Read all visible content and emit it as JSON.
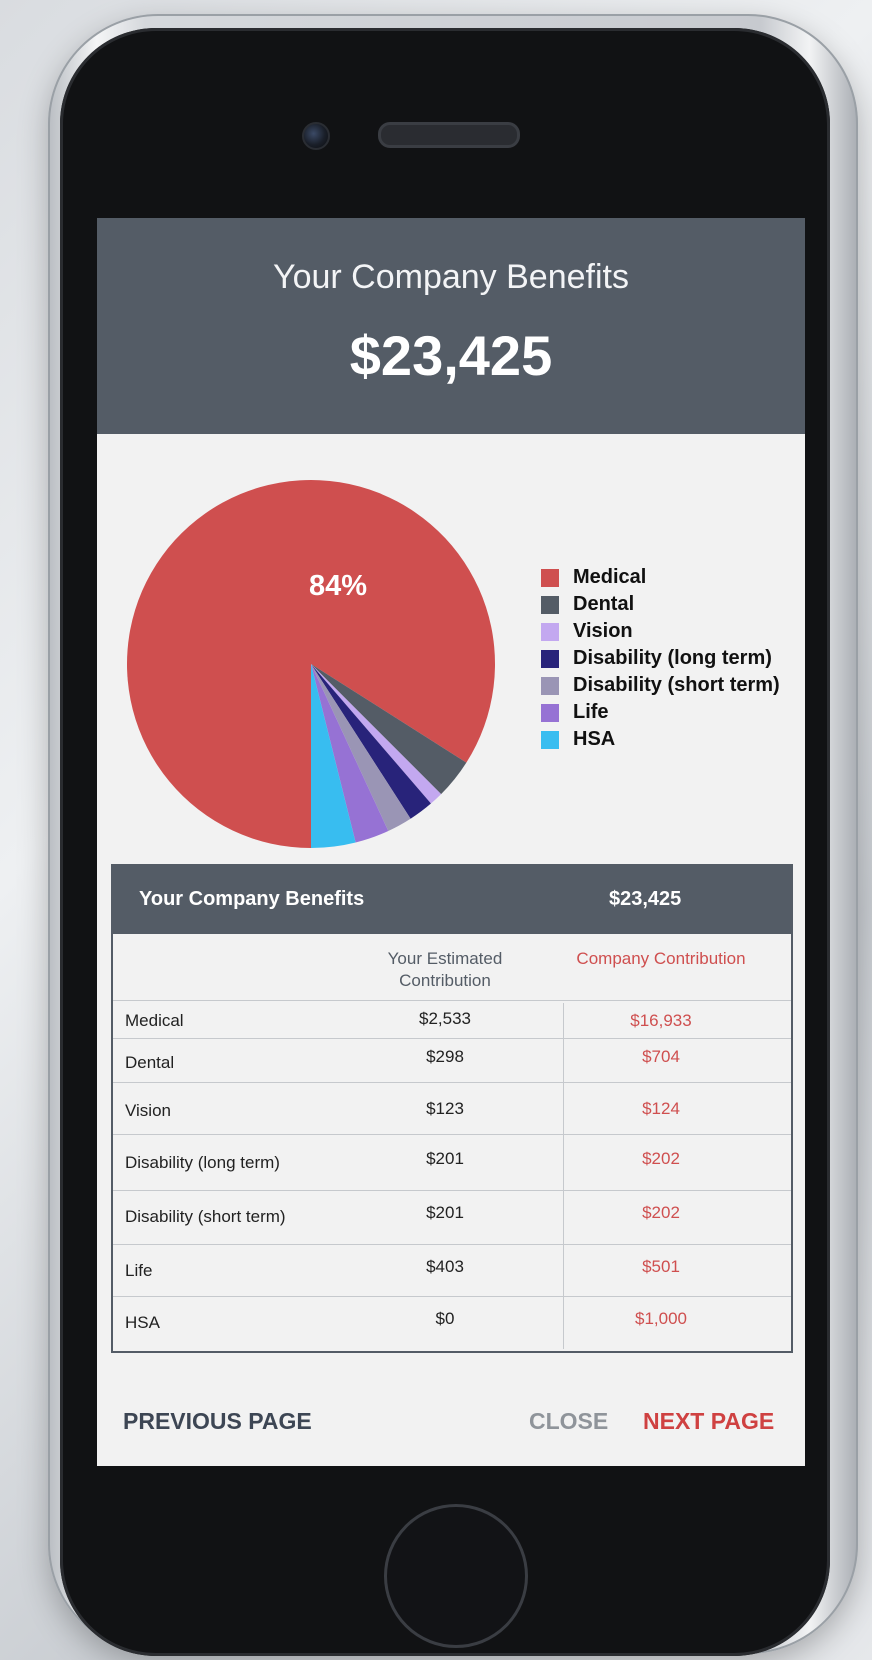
{
  "header": {
    "title": "Your Company Benefits",
    "amount": "$23,425"
  },
  "chart": {
    "highlight_label": "84%"
  },
  "chart_data": {
    "type": "pie",
    "title": "",
    "categories": [
      "Medical",
      "Dental",
      "Vision",
      "Disability (long term)",
      "Disability (short term)",
      "Life",
      "HSA"
    ],
    "values": [
      84,
      3.5,
      1.2,
      2.2,
      2.2,
      3.0,
      3.9
    ],
    "colors": [
      "#cf4f4f",
      "#545c66",
      "#c3a8f0",
      "#28237a",
      "#9a95b5",
      "#9672d4",
      "#38bdf0"
    ],
    "legend_position": "right"
  },
  "legend": [
    {
      "label": "Medical",
      "color": "#cf4f4f"
    },
    {
      "label": "Dental",
      "color": "#545c66"
    },
    {
      "label": "Vision",
      "color": "#c3a8f0"
    },
    {
      "label": "Disability (long term)",
      "color": "#28237a"
    },
    {
      "label": "Disability (short term)",
      "color": "#9a95b5"
    },
    {
      "label": "Life",
      "color": "#9672d4"
    },
    {
      "label": "HSA",
      "color": "#38bdf0"
    }
  ],
  "table": {
    "header_label": "Your Company Benefits",
    "header_value": "$23,425",
    "col_yours": "Your Estimated Contribution",
    "col_company": "Company Contribution",
    "rows": [
      {
        "name": "Medical",
        "yours": "$2,533",
        "company": "$16,933"
      },
      {
        "name": "Dental",
        "yours": "$298",
        "company": "$704"
      },
      {
        "name": "Vision",
        "yours": "$123",
        "company": "$124"
      },
      {
        "name": "Disability (long term)",
        "yours": "$201",
        "company": "$202"
      },
      {
        "name": "Disability (short term)",
        "yours": "$201",
        "company": "$202"
      },
      {
        "name": "Life",
        "yours": "$403",
        "company": "$501"
      },
      {
        "name": "HSA",
        "yours": "$0",
        "company": "$1,000"
      }
    ]
  },
  "footer": {
    "previous": "PREVIOUS PAGE",
    "close": "CLOSE",
    "next": "NEXT PAGE"
  }
}
